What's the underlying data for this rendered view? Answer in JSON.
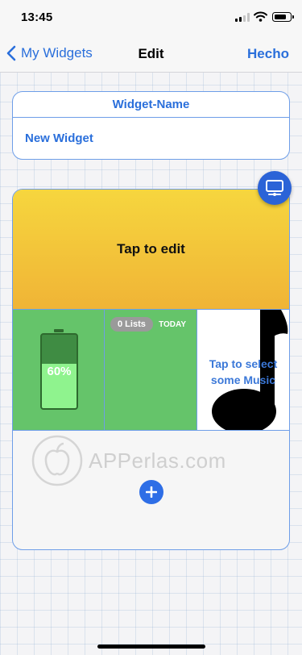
{
  "status_bar": {
    "time": "13:45",
    "battery_level": 0.75
  },
  "nav": {
    "back_label": "My Widgets",
    "title": "Edit",
    "done_label": "Hecho"
  },
  "name_card": {
    "header": "Widget-Name",
    "value": "New Widget"
  },
  "widget": {
    "banner_text": "Tap to edit",
    "battery_tile": {
      "label": "60%",
      "level": 0.6
    },
    "lists_tile": {
      "badge": "0 Lists",
      "date_label": "TODAY"
    },
    "music_tile": {
      "line1": "Tap to select",
      "line2": "some Music"
    }
  },
  "watermark": {
    "text": "APPerlas.com"
  },
  "colors": {
    "accent": "#2a6fdb",
    "banner_top": "#f6d63e",
    "banner_bottom": "#f0b436",
    "tile_green": "#65c46a"
  },
  "icons": {
    "back": "chevron-left-icon",
    "add": "plus-icon",
    "preview": "monitor-icon"
  }
}
